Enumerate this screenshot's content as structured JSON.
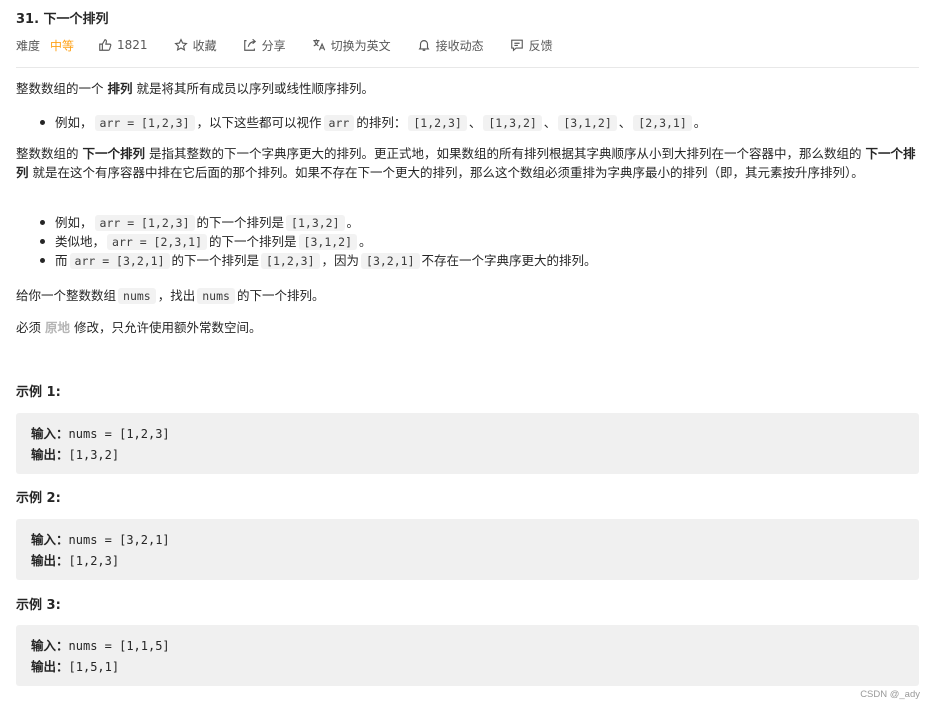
{
  "problem": {
    "title": "31. 下一个排列"
  },
  "meta": {
    "difficulty_label": "难度",
    "difficulty_value": "中等",
    "difficulty_color": "#ffa116",
    "likes": "1821",
    "favorite": "收藏",
    "share": "分享",
    "switch_lang": "切换为英文",
    "notify": "接收动态",
    "feedback": "反馈"
  },
  "description": {
    "p1": {
      "a": "整数数组的一个 ",
      "b": "排列",
      "c": " 就是将其所有成员以序列或线性顺序排列。"
    },
    "bullet1": {
      "a": "例如，",
      "code1": "arr = [1,2,3]",
      "b": "，以下这些都可以视作",
      "code2": "arr",
      "c": "的排列：",
      "code3": "[1,2,3]",
      "sep1": "、",
      "code4": "[1,3,2]",
      "sep2": "、",
      "code5": "[3,1,2]",
      "sep3": "、",
      "code6": "[2,3,1]",
      "end": "。"
    },
    "p2": {
      "a": "整数数组的 ",
      "b": "下一个排列",
      "c": " 是指其整数的下一个字典序更大的排列。更正式地，如果数组的所有排列根据其字典顺序从小到大排列在一个容器中，那么数组的 ",
      "d": "下一个排列",
      "e": " 就是在这个有序容器中排在它后面的那个排列。如果不存在下一个更大的排列，那么这个数组必须重排为字典序最小的排列（即，其元素按升序排列）。"
    },
    "bullets2": [
      {
        "a": "例如，",
        "code1": "arr = [1,2,3]",
        "b": "的下一个排列是",
        "code2": "[1,3,2]",
        "c": "。"
      },
      {
        "a": "类似地，",
        "code1": "arr = [2,3,1]",
        "b": "的下一个排列是",
        "code2": "[3,1,2]",
        "c": "。"
      },
      {
        "a": "而",
        "code1": "arr = [3,2,1]",
        "b": "的下一个排列是",
        "code2": "[1,2,3]",
        "c": "，因为",
        "code3": "[3,2,1]",
        "d": "不存在一个字典序更大的排列。"
      }
    ],
    "p3": {
      "a": "给你一个整数数组",
      "code1": "nums",
      "b": "，找出",
      "code2": "nums",
      "c": "的下一个排列。"
    },
    "p4": {
      "a": "必须 ",
      "b": "原地",
      "c": " 修改，只允许使用额外常数空间。"
    }
  },
  "examples": [
    {
      "title": "示例 1:",
      "input_label": "输入：",
      "input": "nums = [1,2,3]",
      "output_label": "输出：",
      "output": "[1,3,2]"
    },
    {
      "title": "示例 2:",
      "input_label": "输入：",
      "input": "nums = [3,2,1]",
      "output_label": "输出：",
      "output": "[1,2,3]"
    },
    {
      "title": "示例 3:",
      "input_label": "输入：",
      "input": "nums = [1,1,5]",
      "output_label": "输出：",
      "output": "[1,5,1]"
    }
  ],
  "watermark": "CSDN @_ady"
}
